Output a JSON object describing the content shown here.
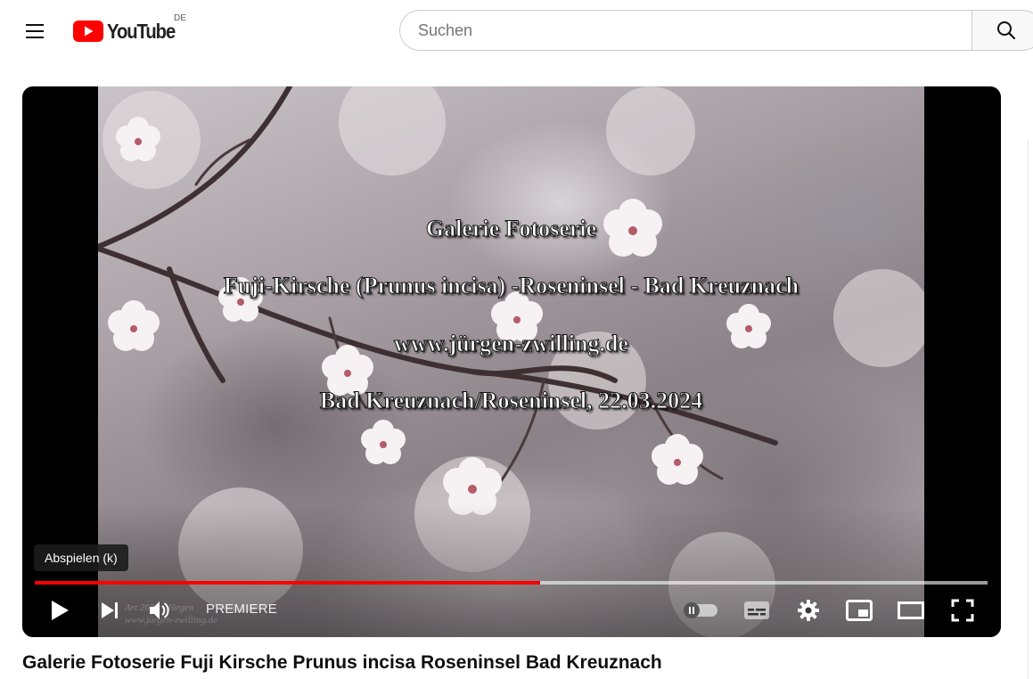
{
  "header": {
    "logo_text": "YouTube",
    "country_code": "DE",
    "menu_icon": "hamburger-icon",
    "search": {
      "placeholder": "Suchen",
      "value": "",
      "icon": "search-icon"
    }
  },
  "player": {
    "overlay_lines": [
      "Galerie Fotoserie",
      "Fuji-Kirsche (Prunus incisa) -Roseninsel - Bad Kreuznach",
      "www.jürgen-zwilling.de",
      "Bad Kreuznach/Roseninsel,  22.03.2024"
    ],
    "tooltip": "Abspielen (k)",
    "progress_played_fraction": 0.53,
    "premiere_label": "PREMIERE",
    "controls": {
      "play": "play-icon",
      "next": "next-icon",
      "volume": "volume-icon",
      "autoplay": "autoplay-toggle-icon",
      "subtitles": "subtitles-icon",
      "settings": "gear-icon",
      "miniplayer": "miniplayer-icon",
      "theater": "theater-mode-icon",
      "fullscreen": "fullscreen-icon"
    },
    "colors": {
      "progress_played": "#ff0000",
      "brand_red": "#ff0000"
    }
  },
  "video": {
    "title": "Galerie Fotoserie Fuji Kirsche Prunus incisa Roseninsel Bad Kreuznach"
  }
}
